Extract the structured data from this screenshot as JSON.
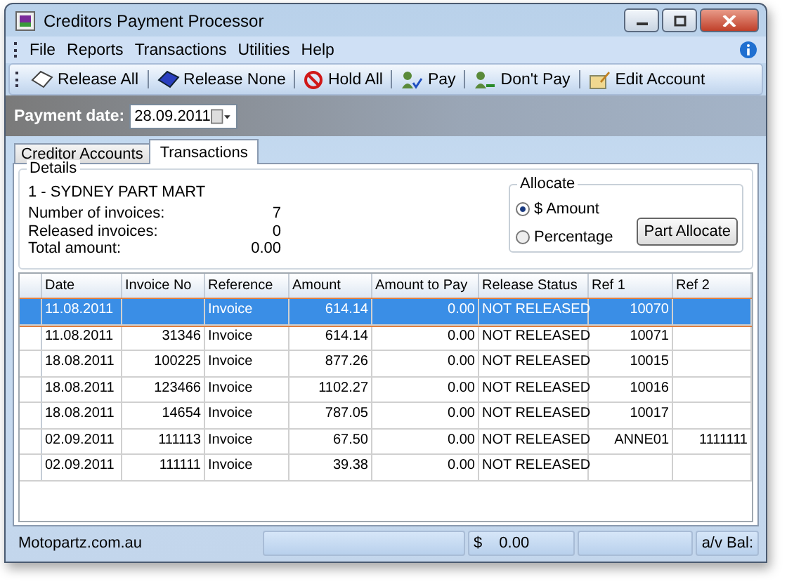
{
  "window": {
    "title": "Creditors Payment Processor"
  },
  "menu": [
    "File",
    "Reports",
    "Transactions",
    "Utilities",
    "Help"
  ],
  "toolbar": [
    "Release All",
    "Release None",
    "Hold All",
    "Pay",
    "Don't Pay",
    "Edit Account"
  ],
  "payment_date": {
    "label": "Payment date:",
    "value": "28.09.2011"
  },
  "tabs": [
    {
      "label": "Creditor Accounts",
      "selected": false
    },
    {
      "label": "Transactions",
      "selected": true
    }
  ],
  "details": {
    "title": "Details",
    "account": "1 - SYDNEY PART MART",
    "fields": [
      {
        "label": "Number of invoices:",
        "value": "7"
      },
      {
        "label": "Released invoices:",
        "value": "0"
      },
      {
        "label": "Total amount:",
        "value": "0.00"
      }
    ]
  },
  "allocate": {
    "title": "Allocate",
    "options": [
      {
        "label": "$ Amount",
        "selected": true
      },
      {
        "label": "Percentage",
        "selected": false
      }
    ],
    "button": "Part Allocate"
  },
  "table": {
    "columns": [
      "Date",
      "Invoice No",
      "Reference",
      "Amount",
      "Amount to Pay",
      "Release Status",
      "Ref 1",
      "Ref 2"
    ],
    "rows": [
      {
        "selected": true,
        "cells": [
          "11.08.2011",
          "",
          "Invoice",
          "614.14",
          "0.00",
          "NOT RELEASED",
          "10070",
          ""
        ]
      },
      {
        "selected": false,
        "cells": [
          "11.08.2011",
          "31346",
          "Invoice",
          "614.14",
          "0.00",
          "NOT RELEASED",
          "10071",
          ""
        ]
      },
      {
        "selected": false,
        "cells": [
          "18.08.2011",
          "100225",
          "Invoice",
          "877.26",
          "0.00",
          "NOT RELEASED",
          "10015",
          ""
        ]
      },
      {
        "selected": false,
        "cells": [
          "18.08.2011",
          "123466",
          "Invoice",
          "1102.27",
          "0.00",
          "NOT RELEASED",
          "10016",
          ""
        ]
      },
      {
        "selected": false,
        "cells": [
          "18.08.2011",
          "14654",
          "Invoice",
          "787.05",
          "0.00",
          "NOT RELEASED",
          "10017",
          ""
        ]
      },
      {
        "selected": false,
        "cells": [
          "02.09.2011",
          "111113",
          "Invoice",
          "67.50",
          "0.00",
          "NOT RELEASED",
          "ANNE01",
          "1111111"
        ]
      },
      {
        "selected": false,
        "cells": [
          "02.09.2011",
          "111111",
          "Invoice",
          "39.38",
          "0.00",
          "NOT RELEASED",
          "",
          ""
        ]
      }
    ]
  },
  "status_bar": {
    "site": "Motopartz.com.au",
    "currency": "$",
    "amount": "0.00",
    "balance_label": "a/v Bal:"
  }
}
